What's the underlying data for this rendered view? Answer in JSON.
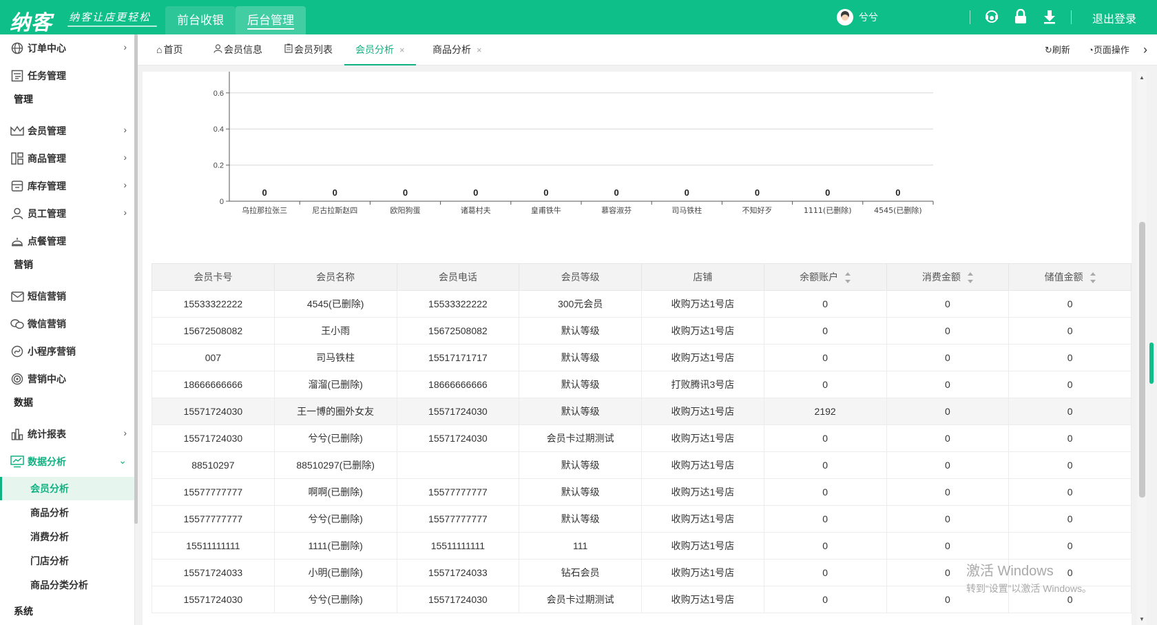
{
  "brand": {
    "logo": "纳客",
    "slogan": "纳客让店更轻松"
  },
  "top_nav": [
    {
      "label": "前台收银"
    },
    {
      "label": "后台管理"
    }
  ],
  "user": {
    "name": "兮兮"
  },
  "top_actions": {
    "logout": "退出登录"
  },
  "sidebar": {
    "items": [
      {
        "label": "订单中心",
        "icon": "globe-icon",
        "arrow": "›"
      },
      {
        "label": "任务管理",
        "icon": "task-icon"
      }
    ],
    "section_manage": "管理",
    "manage_items": [
      {
        "label": "会员管理",
        "icon": "crown-icon",
        "arrow": "›"
      },
      {
        "label": "商品管理",
        "icon": "product-icon",
        "arrow": "›"
      },
      {
        "label": "库存管理",
        "icon": "inventory-icon",
        "arrow": "›"
      },
      {
        "label": "员工管理",
        "icon": "person-icon",
        "arrow": "›"
      },
      {
        "label": "点餐管理",
        "icon": "bell-icon"
      }
    ],
    "section_marketing": "营销",
    "marketing_items": [
      {
        "label": "短信营销",
        "icon": "mail-icon"
      },
      {
        "label": "微信营销",
        "icon": "wechat-icon"
      },
      {
        "label": "小程序营销",
        "icon": "miniprogram-icon"
      },
      {
        "label": "营销中心",
        "icon": "target-icon"
      }
    ],
    "section_data": "数据",
    "data_items": [
      {
        "label": "统计报表",
        "icon": "bar-chart-icon",
        "arrow": "›"
      },
      {
        "label": "数据分析",
        "icon": "monitor-chart-icon",
        "arrow": "⌄"
      }
    ],
    "sub_items": [
      {
        "label": "会员分析"
      },
      {
        "label": "商品分析"
      },
      {
        "label": "消费分析"
      },
      {
        "label": "门店分析"
      },
      {
        "label": "商品分类分析"
      }
    ],
    "section_system": "系统"
  },
  "tabs": [
    {
      "label": "首页"
    },
    {
      "label": "会员信息"
    },
    {
      "label": "会员列表"
    },
    {
      "label": "会员分析",
      "close": "×"
    },
    {
      "label": "商品分析",
      "close": "×"
    }
  ],
  "tab_actions": {
    "refresh": "刷新",
    "page_ops": "页面操作",
    "more": "›"
  },
  "chart_data": {
    "type": "bar",
    "categories": [
      "乌拉那拉张三",
      "尼古拉斯赵四",
      "欧阳狗蛋",
      "诸葛村夫",
      "皇甫铁牛",
      "慕容淑芬",
      "司马铁柱",
      "不知好歹",
      "1111(已删除)",
      "4545(已删除)"
    ],
    "values": [
      0,
      0,
      0,
      0,
      0,
      0,
      0,
      0,
      0,
      0
    ],
    "y_ticks": [
      "0",
      "0.2",
      "0.4",
      "0.6"
    ],
    "ylim": [
      0,
      0.6
    ],
    "grid": true,
    "title": "",
    "xlabel": "",
    "ylabel": ""
  },
  "table": {
    "columns": [
      "会员卡号",
      "会员名称",
      "会员电话",
      "会员等级",
      "店铺",
      "余额账户",
      "消费金额",
      "储值金额"
    ],
    "rows": [
      [
        "15533322222",
        "4545(已删除)",
        "15533322222",
        "300元会员",
        "收购万达1号店",
        "0",
        "0",
        "0"
      ],
      [
        "15672508082",
        "王小雨",
        "15672508082",
        "默认等级",
        "收购万达1号店",
        "0",
        "0",
        "0"
      ],
      [
        "007",
        "司马铁柱",
        "15517171717",
        "默认等级",
        "收购万达1号店",
        "0",
        "0",
        "0"
      ],
      [
        "18666666666",
        "溜溜(已删除)",
        "18666666666",
        "默认等级",
        "打败腾讯3号店",
        "0",
        "0",
        "0"
      ],
      [
        "15571724030",
        "王一博的圈外女友",
        "15571724030",
        "默认等级",
        "收购万达1号店",
        "2192",
        "0",
        "0"
      ],
      [
        "15571724030",
        "兮兮(已删除)",
        "15571724030",
        "会员卡过期测试",
        "收购万达1号店",
        "0",
        "0",
        "0"
      ],
      [
        "88510297",
        "88510297(已删除)",
        "",
        "默认等级",
        "收购万达1号店",
        "0",
        "0",
        "0"
      ],
      [
        "15577777777",
        "啊啊(已删除)",
        "15577777777",
        "默认等级",
        "收购万达1号店",
        "0",
        "0",
        "0"
      ],
      [
        "15577777777",
        "兮兮(已删除)",
        "15577777777",
        "默认等级",
        "收购万达1号店",
        "0",
        "0",
        "0"
      ],
      [
        "15511111111",
        "1111(已删除)",
        "15511111111",
        "111",
        "收购万达1号店",
        "0",
        "0",
        "0"
      ],
      [
        "15571724033",
        "小明(已删除)",
        "15571724033",
        "钻石会员",
        "收购万达1号店",
        "0",
        "0",
        "0"
      ],
      [
        "15571724030",
        "兮兮(已删除)",
        "15571724030",
        "会员卡过期测试",
        "收购万达1号店",
        "0",
        "0",
        "0"
      ]
    ]
  },
  "watermark": {
    "line1": "激活 Windows",
    "line2": "转到“设置”以激活 Windows。"
  },
  "colors": {
    "brand": "#0fbf8a",
    "active": "#10b281"
  }
}
